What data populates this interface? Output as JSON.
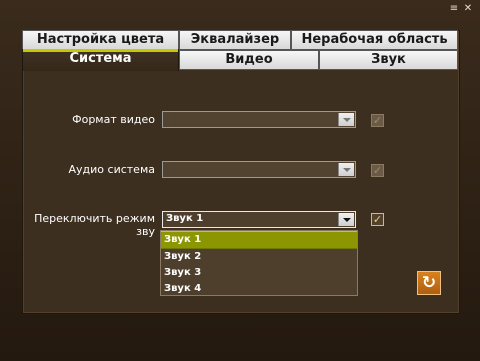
{
  "window": {
    "icons": [
      "menu-icon",
      "close-icon"
    ]
  },
  "tabs": {
    "back_row": [
      {
        "label": "Настройка цвета"
      },
      {
        "label": "Эквалайзер"
      },
      {
        "label": "Нерабочая область"
      }
    ],
    "front_row": [
      {
        "label": "Система",
        "active": true
      },
      {
        "label": "Видео"
      },
      {
        "label": "Звук"
      }
    ]
  },
  "settings": {
    "video_format": {
      "label": "Формат видео",
      "value": "",
      "checked": false
    },
    "audio_system": {
      "label": "Аудио система",
      "value": "",
      "checked": false
    },
    "sound_mode": {
      "label": "Переключить режим зву",
      "value": "Звук 1",
      "checked": true
    }
  },
  "sound_mode_options": [
    {
      "label": "Звук 1",
      "selected": true
    },
    {
      "label": "Звук 2"
    },
    {
      "label": "Звук 3"
    },
    {
      "label": "Звук 4"
    }
  ],
  "colors": {
    "accent": "#c8c800",
    "selected_option": "#8b9600",
    "refresh_button": "#d8821c"
  }
}
